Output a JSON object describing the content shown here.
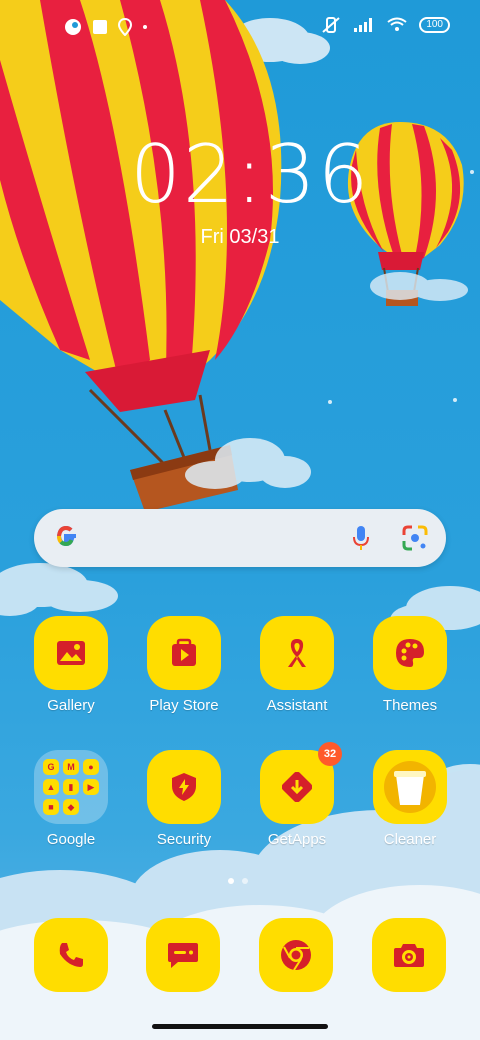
{
  "status_bar": {
    "battery_level": "100",
    "icons": [
      "notification-app-icon",
      "notification-square-icon",
      "location-pin-icon",
      "dot-icon",
      "vibrate-off-icon",
      "signal-icon",
      "wifi-icon",
      "battery-icon"
    ]
  },
  "clock": {
    "time": "02:36",
    "date": "Fri 03/31"
  },
  "search": {
    "logo": "G",
    "mic_icon": "mic-icon",
    "lens_icon": "lens-icon"
  },
  "apps": [
    {
      "label": "Gallery",
      "icon": "gallery-icon"
    },
    {
      "label": "Play Store",
      "icon": "play-store-icon"
    },
    {
      "label": "Assistant",
      "icon": "assistant-icon"
    },
    {
      "label": "Themes",
      "icon": "themes-icon"
    },
    {
      "label": "Google",
      "icon": "folder-icon"
    },
    {
      "label": "Security",
      "icon": "security-icon"
    },
    {
      "label": "GetApps",
      "icon": "getapps-icon",
      "badge": "32"
    },
    {
      "label": "Cleaner",
      "icon": "cleaner-icon"
    }
  ],
  "dock": [
    {
      "icon": "phone-icon"
    },
    {
      "icon": "messages-icon"
    },
    {
      "icon": "chrome-icon"
    },
    {
      "icon": "camera-icon"
    }
  ],
  "colors": {
    "tile": "#ffdd00",
    "glyph": "#d5202a",
    "sky": "#1f9ad8",
    "badge": "#ff5a2b"
  },
  "page_indicator": {
    "pages": 2,
    "current": 1
  }
}
